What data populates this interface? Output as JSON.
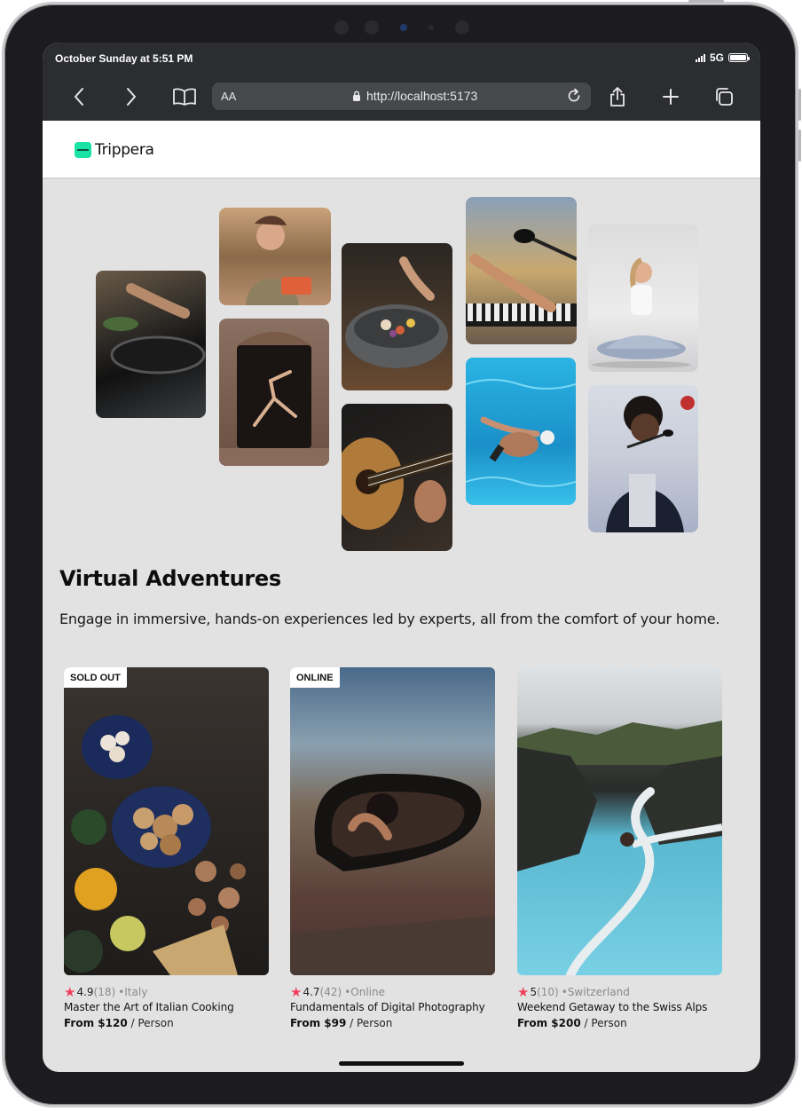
{
  "status_bar": {
    "time": "October Sunday at 5:51 PM",
    "network": "5G"
  },
  "browser": {
    "aa_label": "AA",
    "url": "http://localhost:5173",
    "icons": [
      "back-icon",
      "forward-icon",
      "bookmarks-icon",
      "lock-icon",
      "reload-icon",
      "share-icon",
      "new-tab-icon",
      "tabs-icon"
    ]
  },
  "site": {
    "logo": "Trippera"
  },
  "hero": {
    "images": [
      "cooking-pans",
      "woman-with-tray",
      "dancer-in-doorway",
      "stone-bowl-dish",
      "acoustic-guitar",
      "piano-microphone",
      "swimmer-in-pool",
      "yoga-meditation",
      "singer-microphone"
    ]
  },
  "section": {
    "title": "Virtual Adventures",
    "description": "Engage in immersive, hands-on experiences led by experts, all from the comfort of your home."
  },
  "cards": [
    {
      "badge": "SOLD OUT",
      "rating": "4.9",
      "reviews": "(18)",
      "location": "•Italy",
      "title": "Master the Art of Italian Cooking",
      "price": "From $120",
      "unit": " / Person"
    },
    {
      "badge": "ONLINE",
      "rating": "4.7",
      "reviews": "(42)",
      "location": "•Online",
      "title": "Fundamentals of Digital Photography",
      "price": "From $99",
      "unit": " / Person"
    },
    {
      "badge": "",
      "rating": "5",
      "reviews": "(10)",
      "location": "•Switzerland",
      "title": "Weekend Getaway to the Swiss Alps",
      "price": "From $200",
      "unit": " / Person"
    }
  ],
  "colors": {
    "accent": "#19e3a4",
    "star": "#f0405a",
    "page_bg": "#e2e2e2",
    "browser_bar": "#2b2d30"
  }
}
